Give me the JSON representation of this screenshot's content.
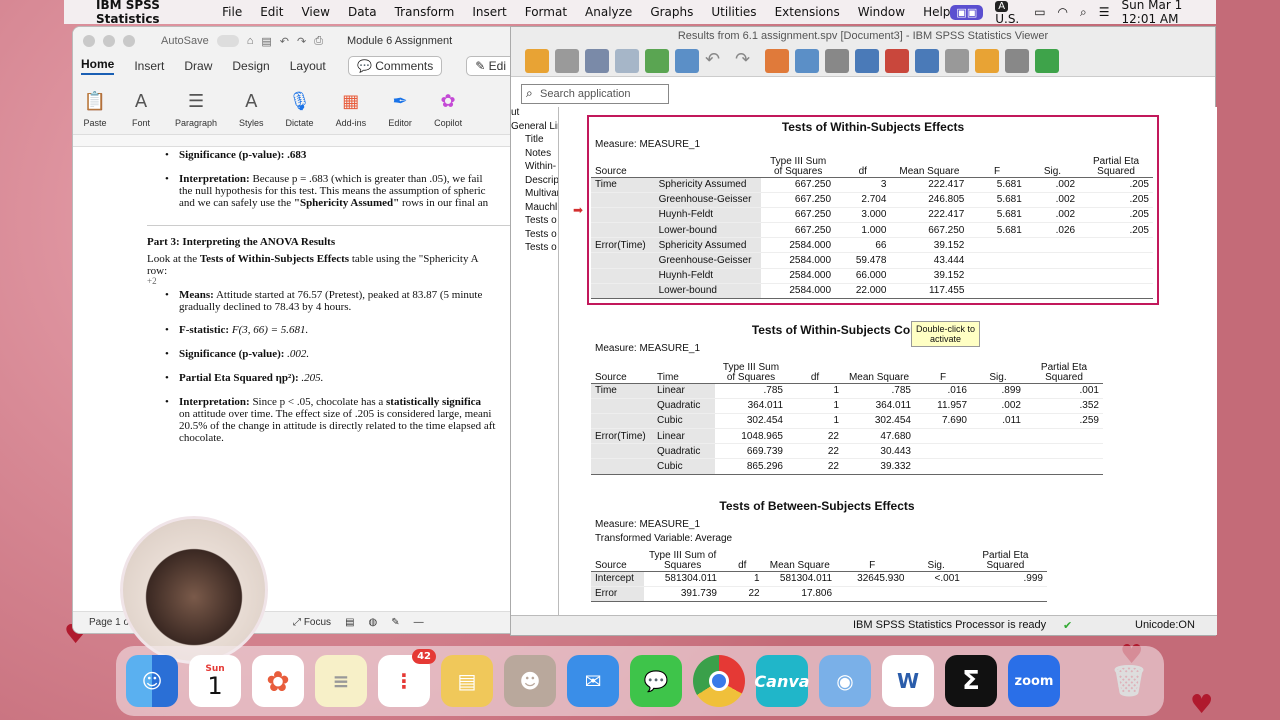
{
  "menubar": {
    "app": "IBM SPSS Statistics",
    "items": [
      "File",
      "Edit",
      "View",
      "Data",
      "Transform",
      "Insert",
      "Format",
      "Analyze",
      "Graphs",
      "Utilities",
      "Extensions",
      "Window",
      "Help"
    ],
    "input_source": "U.S.",
    "datetime": "Sun Mar 1  12:01 AM"
  },
  "word": {
    "autosave": "AutoSave",
    "doc_title": "Module 6 Assignment",
    "tabs": [
      "Home",
      "Insert",
      "Draw",
      "Design",
      "Layout"
    ],
    "comments": "Comments",
    "edit": "Edi",
    "ribbon": [
      "Paste",
      "Font",
      "Paragraph",
      "Styles",
      "Dictate",
      "Add-ins",
      "Editor",
      "Copilot"
    ],
    "lines": {
      "sig_prev": "Significance (p-value): .683",
      "interp_prev_label": "Interpretation:",
      "interp_prev_1": " Because p = .683 (which is greater than .05), we fail",
      "interp_prev_2": "the null hypothesis for this test. This means the assumption of spheric",
      "interp_prev_3a": "and we can safely use the ",
      "interp_prev_3b": "\"Sphericity Assumed\"",
      "interp_prev_3c": " rows in our final an",
      "part3": "Part 3: Interpreting the ANOVA Results",
      "look_1a": "Look at the ",
      "look_1b": "Tests of Within-Subjects Effects",
      "look_1c": " table using the \"Sphericity A",
      "look_2": "row:",
      "plus2": "+2",
      "means_label": "Means:",
      "means_1": " Attitude started at 76.57 (Pretest), peaked at 83.87 (5 minute",
      "means_2": "gradually declined to 78.43 by 4 hours.",
      "f_label": "F-statistic:",
      "f_val": " F(3, 66) = 5.681.",
      "sig_label": "Significance (p-value):",
      "sig_val": " .002.",
      "eta_label": "Partial Eta Squared ηp²):",
      "eta_val": " .205.",
      "interp_label": "Interpretation:",
      "interp_1a": " Since p < .05, chocolate has a ",
      "interp_1b": "statistically significa",
      "interp_2": "on attitude over time. The effect size of .205 is considered large, meani",
      "interp_3": "20.5% of the change in attitude is directly related to the time elapsed aft",
      "interp_4": "chocolate."
    },
    "status_page": "Page 1 o",
    "status_focus": "Focus"
  },
  "spss": {
    "title": "Results from 6.1 assignment.spv [Document3] - IBM SPSS Statistics Viewer",
    "search_placeholder": "Search application",
    "outline": [
      "ut",
      "General Line",
      "Title",
      "Notes",
      "Within-",
      "Descrip",
      "Multivar",
      "Mauchl",
      "Tests o",
      "Tests o",
      "Tests o"
    ],
    "status": "IBM SPSS Statistics Processor is ready",
    "unicode": "Unicode:ON",
    "tooltip_1": "Double-click to",
    "tooltip_2": "activate",
    "t1": {
      "title": "Tests of Within-Subjects Effects",
      "measure": "Measure:   MEASURE_1",
      "headers": [
        "Source",
        "",
        "Type III Sum of Squares",
        "df",
        "Mean Square",
        "F",
        "Sig.",
        "Partial Eta Squared"
      ],
      "rows": [
        [
          "Time",
          "Sphericity Assumed",
          "667.250",
          "3",
          "222.417",
          "5.681",
          ".002",
          ".205"
        ],
        [
          "",
          "Greenhouse-Geisser",
          "667.250",
          "2.704",
          "246.805",
          "5.681",
          ".002",
          ".205"
        ],
        [
          "",
          "Huynh-Feldt",
          "667.250",
          "3.000",
          "222.417",
          "5.681",
          ".002",
          ".205"
        ],
        [
          "",
          "Lower-bound",
          "667.250",
          "1.000",
          "667.250",
          "5.681",
          ".026",
          ".205"
        ],
        [
          "Error(Time)",
          "Sphericity Assumed",
          "2584.000",
          "66",
          "39.152",
          "",
          "",
          ""
        ],
        [
          "",
          "Greenhouse-Geisser",
          "2584.000",
          "59.478",
          "43.444",
          "",
          "",
          ""
        ],
        [
          "",
          "Huynh-Feldt",
          "2584.000",
          "66.000",
          "39.152",
          "",
          "",
          ""
        ],
        [
          "",
          "Lower-bound",
          "2584.000",
          "22.000",
          "117.455",
          "",
          "",
          ""
        ]
      ]
    },
    "t2": {
      "title": "Tests of Within-Subjects Contrasts",
      "measure": "Measure:   MEASURE_1",
      "headers": [
        "Source",
        "Time",
        "Type III Sum of Squares",
        "df",
        "Mean Square",
        "F",
        "Sig.",
        "Partial Eta Squared"
      ],
      "rows": [
        [
          "Time",
          "Linear",
          ".785",
          "1",
          ".785",
          ".016",
          ".899",
          ".001"
        ],
        [
          "",
          "Quadratic",
          "364.011",
          "1",
          "364.011",
          "11.957",
          ".002",
          ".352"
        ],
        [
          "",
          "Cubic",
          "302.454",
          "1",
          "302.454",
          "7.690",
          ".011",
          ".259"
        ],
        [
          "Error(Time)",
          "Linear",
          "1048.965",
          "22",
          "47.680",
          "",
          "",
          ""
        ],
        [
          "",
          "Quadratic",
          "669.739",
          "22",
          "30.443",
          "",
          "",
          ""
        ],
        [
          "",
          "Cubic",
          "865.296",
          "22",
          "39.332",
          "",
          "",
          ""
        ]
      ]
    },
    "t3": {
      "title": "Tests of Between-Subjects Effects",
      "measure": "Measure:   MEASURE_1",
      "transformed": "Transformed Variable:   Average",
      "headers": [
        "Source",
        "Type III Sum of Squares",
        "df",
        "Mean Square",
        "F",
        "Sig.",
        "Partial Eta Squared"
      ],
      "rows": [
        [
          "Intercept",
          "581304.011",
          "1",
          "581304.011",
          "32645.930",
          "<.001",
          ".999"
        ],
        [
          "Error",
          "391.739",
          "22",
          "17.806",
          "",
          "",
          ""
        ]
      ]
    }
  },
  "dock": {
    "calendar_month": "Sun",
    "calendar_day": "1",
    "reminders_badge": "42",
    "canva": "Canva",
    "zoom": "zoom"
  }
}
